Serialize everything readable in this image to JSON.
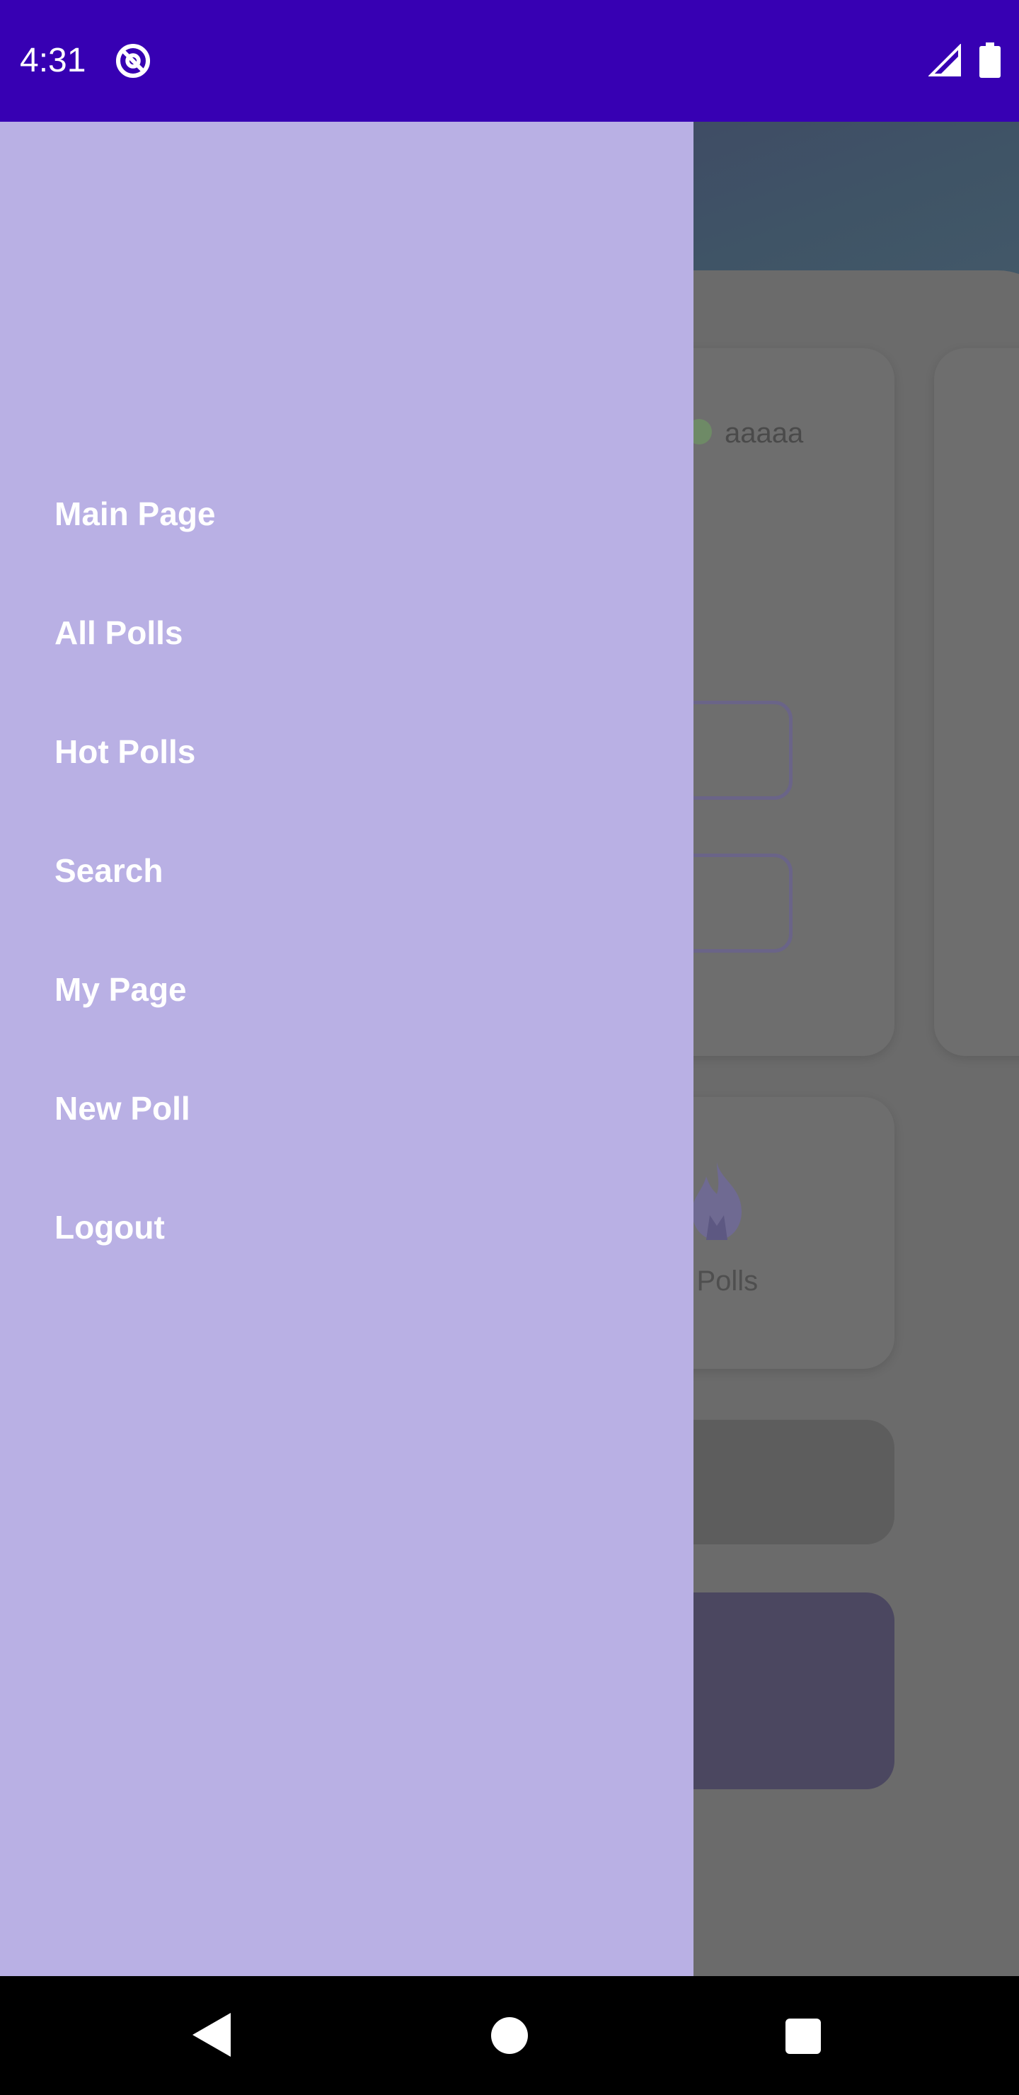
{
  "status_bar": {
    "time": "4:31",
    "app_icon": "at-sign-icon",
    "signal_icon": "signal-icon",
    "battery_icon": "battery-icon"
  },
  "background_app": {
    "user_name": "aaaaa",
    "hot_polls_label": "ot Polls"
  },
  "drawer": {
    "items": [
      {
        "label": "Main Page"
      },
      {
        "label": "All Polls"
      },
      {
        "label": "Hot Polls"
      },
      {
        "label": "Search"
      },
      {
        "label": "My Page"
      },
      {
        "label": "New Poll"
      },
      {
        "label": "Logout"
      }
    ]
  },
  "nav_bar": {
    "back_icon": "back-icon",
    "home_icon": "home-icon",
    "recents_icon": "recents-icon"
  },
  "colors": {
    "status_bar": "#3700B3",
    "drawer_background": "#B9B0E4",
    "drawer_text": "#FFFFFF",
    "scrim": "#6B6B6B"
  }
}
